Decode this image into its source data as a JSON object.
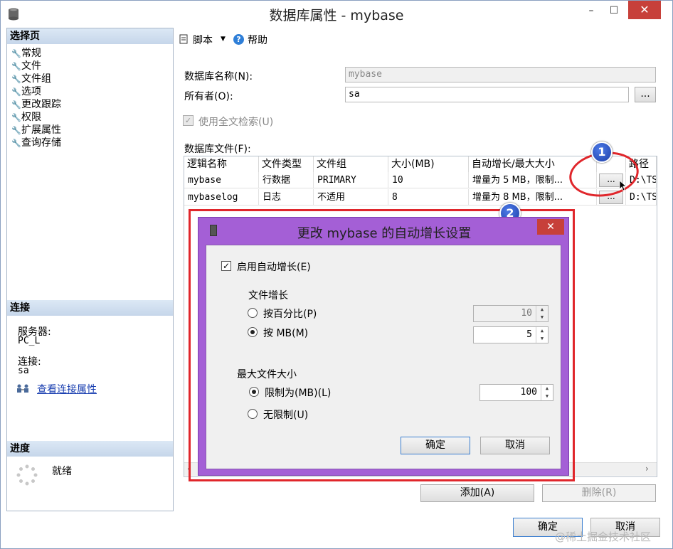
{
  "window": {
    "title": "数据库属性 - mybase",
    "minimize": "–",
    "maximize": "☐",
    "close": "✕"
  },
  "left": {
    "select_page_header": "选择页",
    "nav_items": [
      "常规",
      "文件",
      "文件组",
      "选项",
      "更改跟踪",
      "权限",
      "扩展属性",
      "查询存储"
    ],
    "connection_header": "连接",
    "server_label": "服务器:",
    "server_value": "PC_L",
    "conn_label": "连接:",
    "conn_value": "sa",
    "view_conn_link": "查看连接属性",
    "progress_header": "进度",
    "progress_status": "就绪"
  },
  "toolbar": {
    "script_label": "脚本",
    "help_label": "帮助"
  },
  "form": {
    "db_name_label": "数据库名称(N):",
    "db_name_value": "mybase",
    "owner_label": "所有者(O):",
    "owner_value": "sa",
    "owner_browse": "...",
    "fulltext_label": "使用全文检索(U)",
    "files_label": "数据库文件(F):"
  },
  "grid": {
    "headers": [
      "逻辑名称",
      "文件类型",
      "文件组",
      "大小(MB)",
      "自动增长/最大大小",
      "",
      "路径"
    ],
    "rows": [
      [
        "mybase",
        "行数据",
        "PRIMARY",
        "10",
        "增量为 5 MB，限制...",
        "...",
        "D:\\TS"
      ],
      [
        "mybaselog",
        "日志",
        "不适用",
        "8",
        "增量为 8 MB，限制...",
        "...",
        "D:\\TS"
      ]
    ]
  },
  "buttons": {
    "add": "添加(A)",
    "remove": "删除(R)",
    "ok": "确定",
    "cancel": "取消"
  },
  "dialog": {
    "title": "更改 mybase 的自动增长设置",
    "enable_label": "启用自动增长(E)",
    "file_growth_label": "文件增长",
    "by_percent_label": "按百分比(P)",
    "percent_value": "10",
    "by_mb_label": "按 MB(M)",
    "mb_value": "5",
    "max_size_label": "最大文件大小",
    "limited_label": "限制为(MB)(L)",
    "limited_value": "100",
    "unlimited_label": "无限制(U)",
    "ok": "确定",
    "cancel": "取消"
  },
  "annotations": {
    "badge1": "1",
    "badge2": "2"
  },
  "watermark": "@稀土掘金技术社区",
  "colors": {
    "accent_purple": "#a45fd6",
    "highlight_red": "#e0262b",
    "badge_blue": "#1d3fa8",
    "close_red": "#c7403a"
  }
}
